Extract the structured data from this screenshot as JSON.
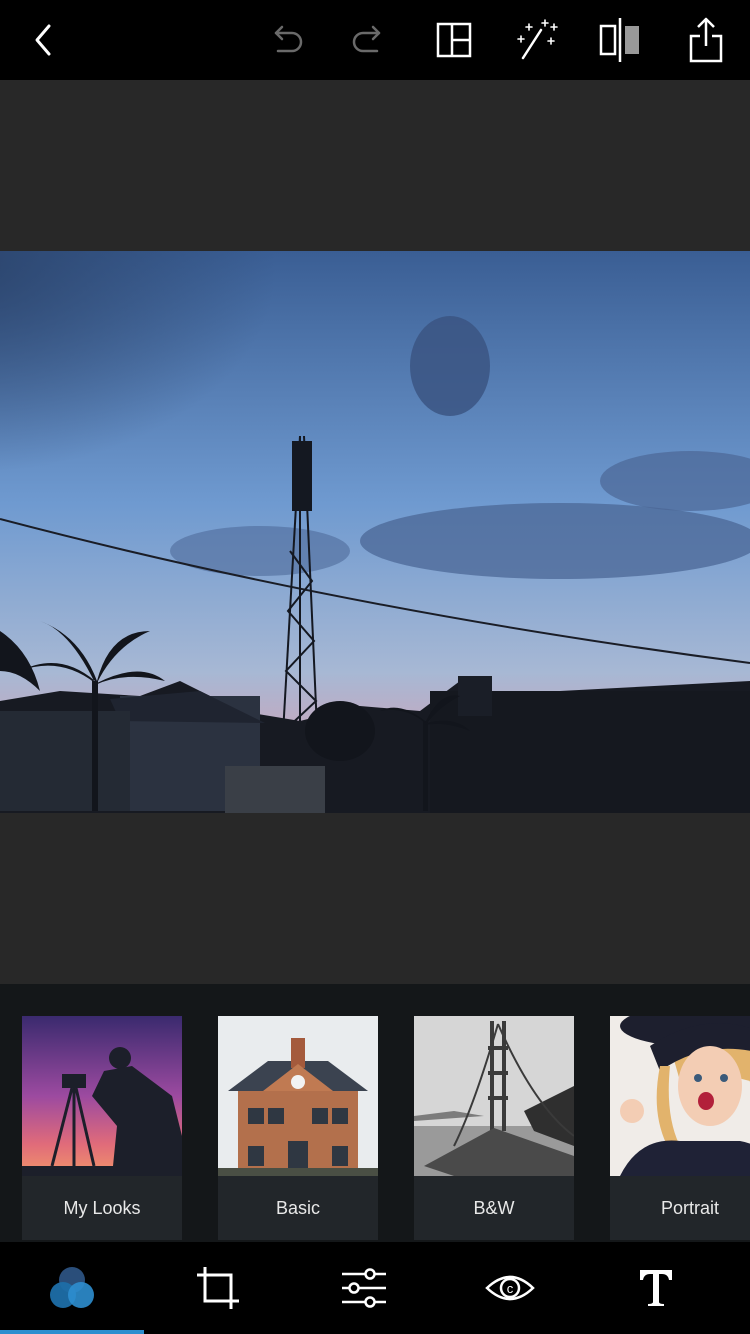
{
  "toolbar": {
    "icons": [
      "back-icon",
      "undo-icon",
      "redo-icon",
      "collage-layout-icon",
      "auto-fix-magic-wand-icon",
      "compare-split-icon",
      "share-icon"
    ]
  },
  "looks": {
    "items": [
      {
        "label": "My Looks"
      },
      {
        "label": "Basic"
      },
      {
        "label": "B&W"
      },
      {
        "label": "Portrait"
      }
    ]
  },
  "bottom_tabs": {
    "icons": [
      "looks-icon",
      "crop-icon",
      "adjustments-sliders-icon",
      "eye-icon",
      "text-icon"
    ],
    "active_index": 0,
    "accent_color": "#2d8ecf"
  }
}
